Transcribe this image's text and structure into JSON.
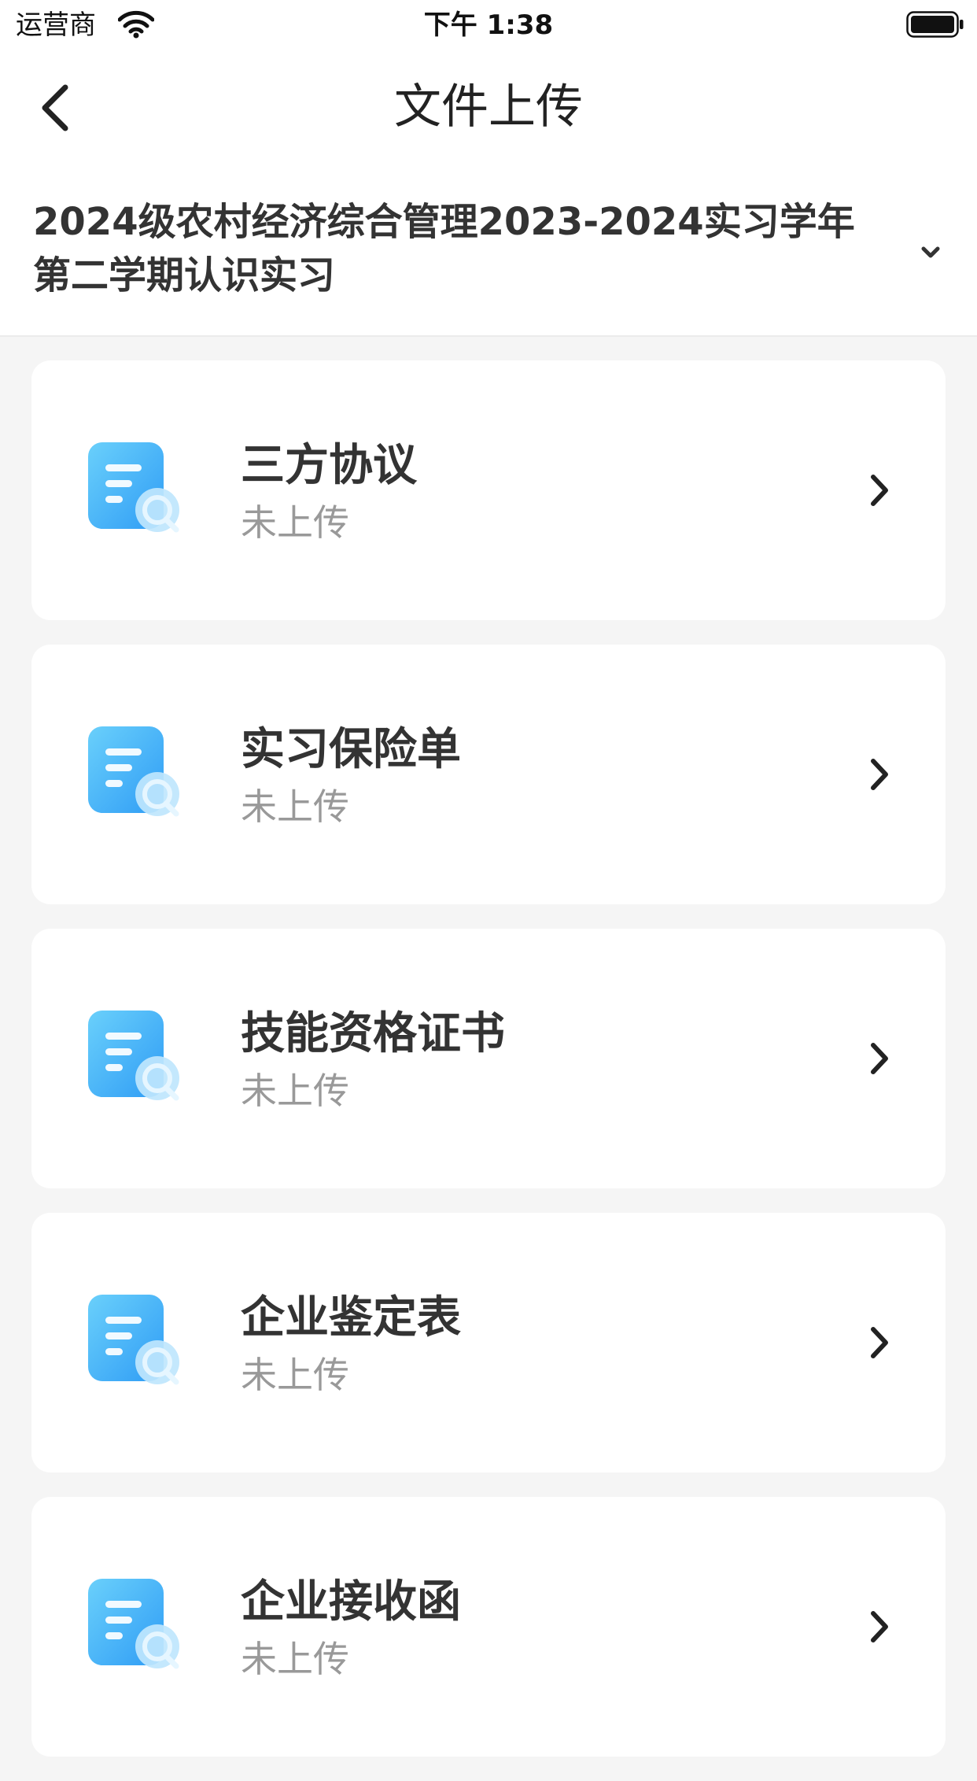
{
  "status_bar": {
    "carrier": "运营商",
    "time": "下午 1:38"
  },
  "nav": {
    "title": "文件上传"
  },
  "term": {
    "label": "2024级农村经济综合管理2023-2024实习学年第二学期认识实习"
  },
  "documents": [
    {
      "title": "三方协议",
      "status": "未上传"
    },
    {
      "title": "实习保险单",
      "status": "未上传"
    },
    {
      "title": "技能资格证书",
      "status": "未上传"
    },
    {
      "title": "企业鉴定表",
      "status": "未上传"
    },
    {
      "title": "企业接收函",
      "status": "未上传"
    }
  ],
  "icons": {
    "back": "chevron-left-icon",
    "term_toggle": "chevron-down-icon",
    "document": "document-search-icon",
    "row_arrow": "chevron-right-icon",
    "wifi": "wifi-icon",
    "battery": "battery-icon"
  },
  "colors": {
    "icon_gradient_start": "#6ad0fb",
    "icon_gradient_end": "#2f9cf5",
    "status_text": "#999999",
    "title_text": "#333333"
  }
}
